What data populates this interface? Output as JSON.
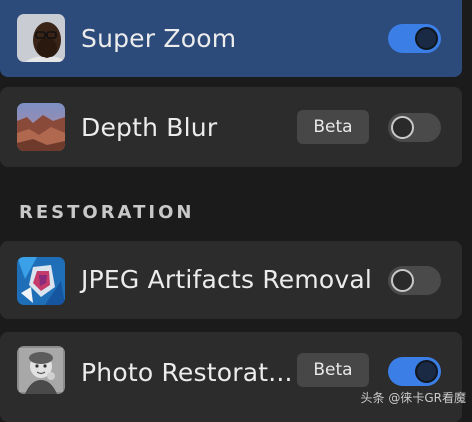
{
  "filters": [
    {
      "label": "Super Zoom",
      "badge": "",
      "toggle_on": true,
      "active": true,
      "thumb": "portrait-man-glasses"
    },
    {
      "label": "Depth Blur",
      "badge": "Beta",
      "toggle_on": false,
      "active": false,
      "thumb": "red-rock-canyon"
    }
  ],
  "section": {
    "title": "RESTORATION"
  },
  "restoration": [
    {
      "label": "JPEG Artifacts Removal",
      "badge": "",
      "toggle_on": false,
      "active": false,
      "thumb": "blue-abstract"
    },
    {
      "label": "Photo Restorat...",
      "badge": "Beta",
      "toggle_on": true,
      "active": false,
      "thumb": "bw-child-photo"
    }
  ],
  "watermark": "头条 @徕卡GR看魔",
  "colors": {
    "active_row": "#2c4a7a",
    "row": "#2c2c2c",
    "toggle_on": "#3b7fe6",
    "toggle_off": "#4a4a4a",
    "background": "#1b1b1b"
  }
}
